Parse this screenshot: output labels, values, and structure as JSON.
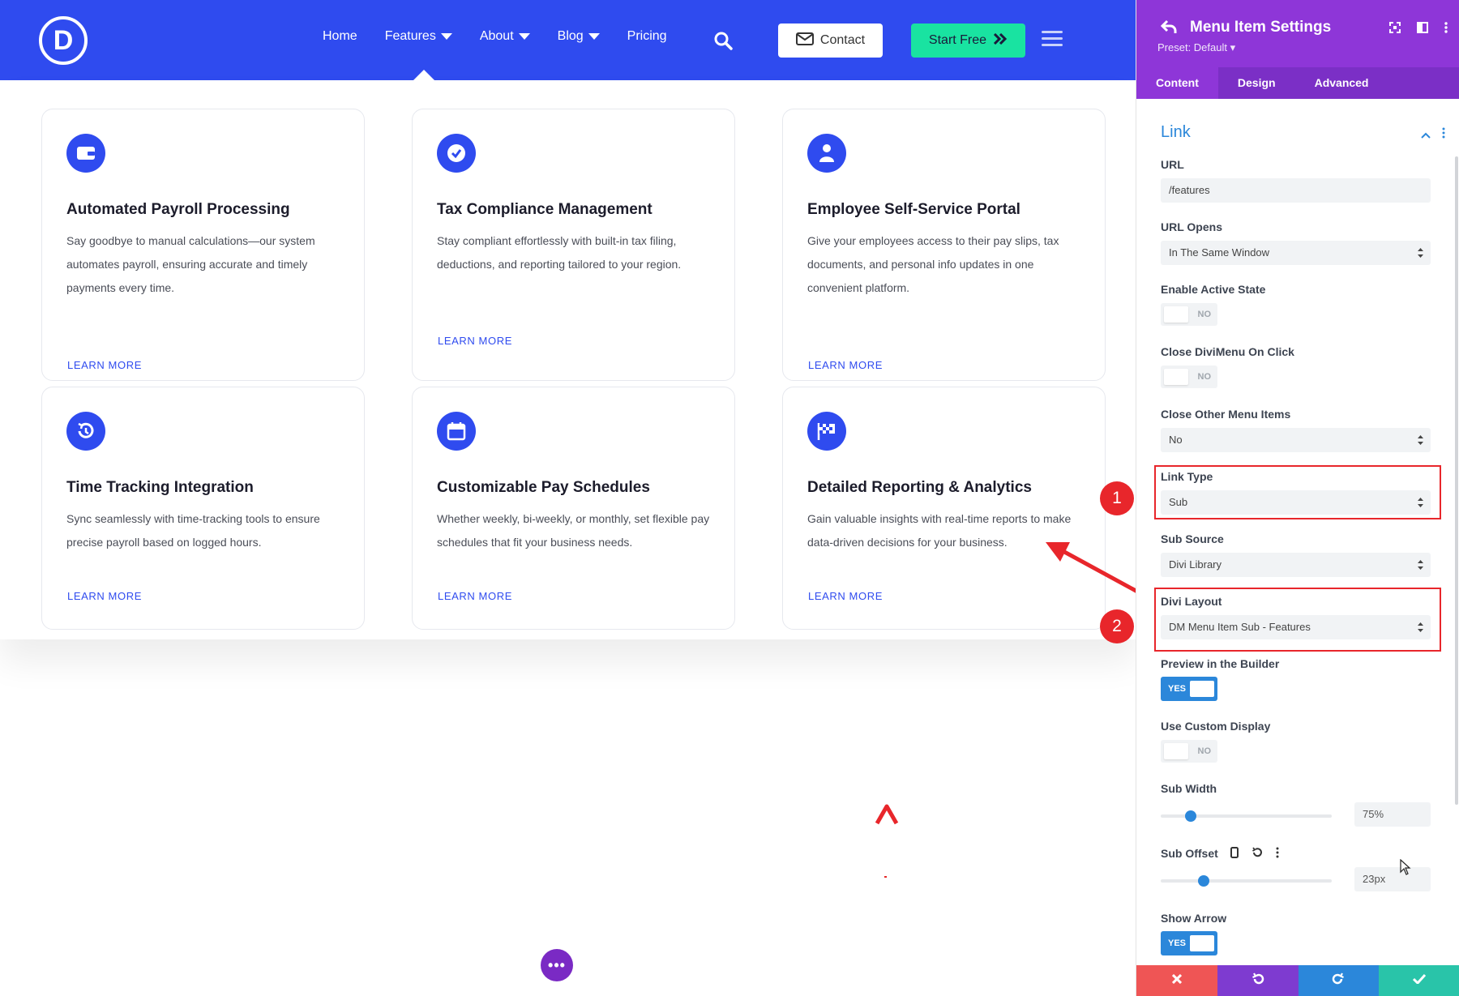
{
  "nav": {
    "logo_letter": "D",
    "items": [
      {
        "label": "Home",
        "dropdown": false
      },
      {
        "label": "Features",
        "dropdown": true
      },
      {
        "label": "About",
        "dropdown": true
      },
      {
        "label": "Blog",
        "dropdown": true
      },
      {
        "label": "Pricing",
        "dropdown": false
      }
    ],
    "contact_label": "Contact",
    "start_label": "Start Free"
  },
  "cards": [
    {
      "icon": "wallet-icon",
      "title": "Automated Payroll Processing",
      "text": "Say goodbye to manual calculations—our system automates payroll, ensuring accurate and timely payments every time.",
      "link": "LEARN MORE"
    },
    {
      "icon": "check-circle-icon",
      "title": "Tax Compliance Management",
      "text": "Stay compliant effortlessly with built-in tax filing, deductions, and reporting tailored to your region.",
      "link": "LEARN MORE"
    },
    {
      "icon": "user-icon",
      "title": "Employee Self-Service Portal",
      "text": "Give your employees access to their pay slips, tax documents, and personal info updates in one convenient platform.",
      "link": "LEARN MORE"
    },
    {
      "icon": "history-icon",
      "title": "Time Tracking Integration",
      "text": "Sync seamlessly with time-tracking tools to ensure precise payroll based on logged hours.",
      "link": "LEARN MORE"
    },
    {
      "icon": "calendar-icon",
      "title": "Customizable Pay Schedules",
      "text": "Whether weekly, bi-weekly, or monthly, set flexible pay schedules that fit your business needs.",
      "link": "LEARN MORE"
    },
    {
      "icon": "flag-icon",
      "title": "Detailed Reporting & Analytics",
      "text": "Gain valuable insights with real-time reports to make data-driven decisions for your business.",
      "link": "LEARN MORE"
    }
  ],
  "panel": {
    "title": "Menu Item Settings",
    "preset": "Preset: Default ▾",
    "tabs": [
      "Content",
      "Design",
      "Advanced"
    ],
    "section": "Link",
    "url_label": "URL",
    "url_value": "/features",
    "url_opens_label": "URL Opens",
    "url_opens_value": "In The Same Window",
    "active_state_label": "Enable Active State",
    "active_state_value": "NO",
    "close_divimenu_label": "Close DiviMenu On Click",
    "close_divimenu_value": "NO",
    "close_other_label": "Close Other Menu Items",
    "close_other_value": "No",
    "link_type_label": "Link Type",
    "link_type_value": "Sub",
    "sub_source_label": "Sub Source",
    "sub_source_value": "Divi Library",
    "divi_layout_label": "Divi Layout",
    "divi_layout_value": "DM Menu Item Sub - Features",
    "preview_label": "Preview in the Builder",
    "preview_value": "YES",
    "custom_display_label": "Use Custom Display",
    "custom_display_value": "NO",
    "sub_width_label": "Sub Width",
    "sub_width_value": "75%",
    "sub_offset_label": "Sub Offset",
    "sub_offset_value": "23px",
    "show_arrow_label": "Show Arrow",
    "show_arrow_value": "YES"
  },
  "annotations": [
    "1",
    "2"
  ],
  "colors": {
    "brand_blue": "#2f4bef",
    "panel_purple": "#8e36d8",
    "accent_green": "#19e3a1",
    "highlight_red": "#e8262b"
  }
}
